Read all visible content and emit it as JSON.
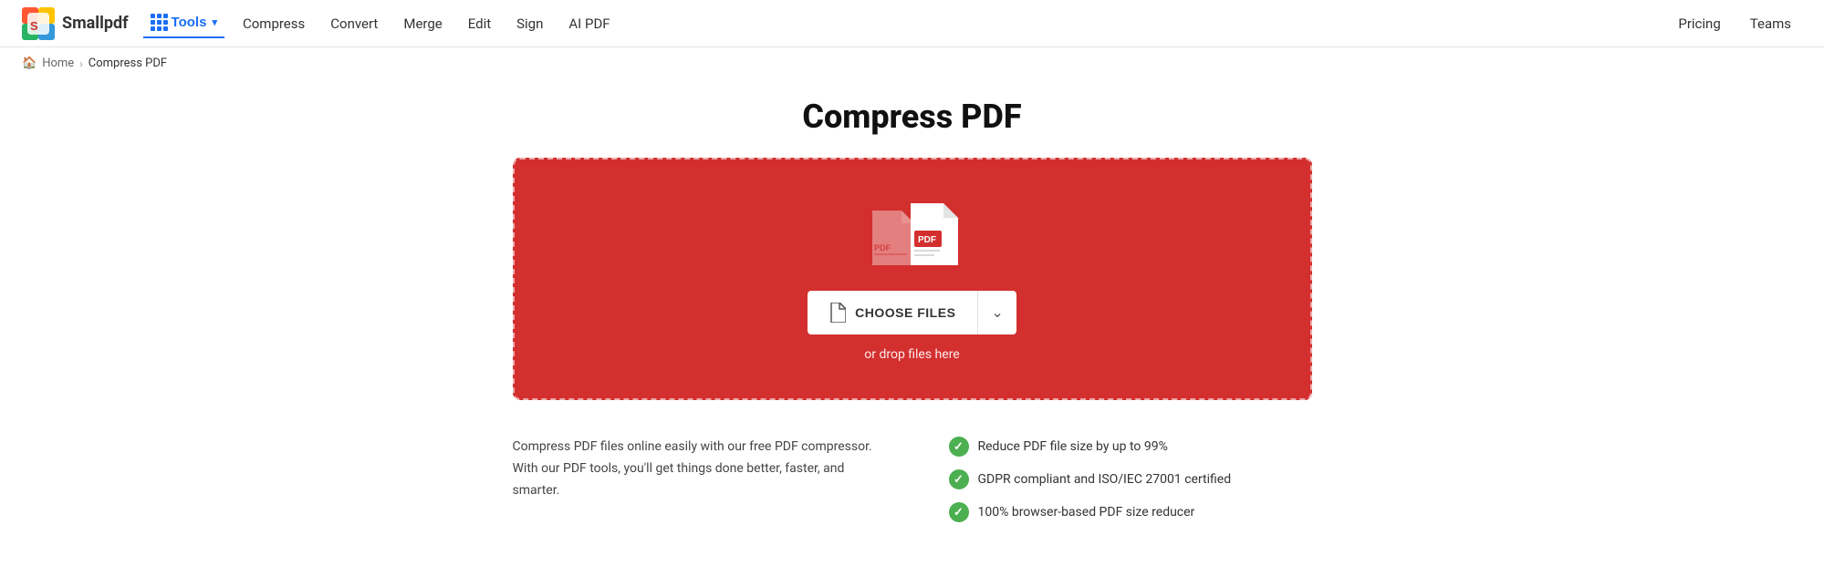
{
  "logo": {
    "text": "Smallpdf",
    "home_href": "#"
  },
  "nav": {
    "tools_label": "Tools",
    "links": [
      {
        "label": "Compress",
        "href": "#"
      },
      {
        "label": "Convert",
        "href": "#"
      },
      {
        "label": "Merge",
        "href": "#"
      },
      {
        "label": "Edit",
        "href": "#"
      },
      {
        "label": "Sign",
        "href": "#"
      },
      {
        "label": "AI PDF",
        "href": "#"
      }
    ]
  },
  "header_right": {
    "pricing_label": "Pricing",
    "teams_label": "Teams"
  },
  "breadcrumb": {
    "home_label": "Home",
    "separator": "›",
    "current": "Compress PDF"
  },
  "page": {
    "title": "Compress PDF",
    "dropzone": {
      "choose_files_label": "CHOOSE FILES",
      "drop_hint": "or drop files here"
    },
    "description": "Compress PDF files online easily with our free PDF compressor. With our PDF tools, you'll get things done better, faster, and smarter.",
    "features": [
      {
        "text": "Reduce PDF file size by up to 99%"
      },
      {
        "text": "GDPR compliant and ISO/IEC 27001 certified"
      },
      {
        "text": "100% browser-based PDF size reducer"
      }
    ]
  },
  "colors": {
    "accent": "#1a6ef5",
    "dropzone_bg": "#d32f2f",
    "feature_check": "#4caf50"
  }
}
